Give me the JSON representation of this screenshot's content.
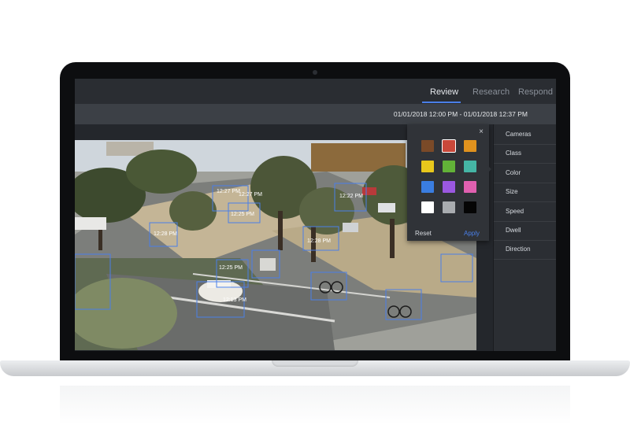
{
  "nav": {
    "tabs": [
      {
        "label": "Review",
        "active": true
      },
      {
        "label": "Research",
        "active": false
      },
      {
        "label": "Respond",
        "active": false
      }
    ]
  },
  "date_range": "01/01/2018 12:00 PM - 01/01/2018 12:37 PM",
  "filters": {
    "items": [
      "Cameras",
      "Class",
      "Color",
      "Size",
      "Speed",
      "Dwell",
      "Direction"
    ]
  },
  "color_picker": {
    "close": "×",
    "swatches": [
      "#7a4a28",
      "#c9483a",
      "#e0921e",
      "#e8c71c",
      "#62b238",
      "#45b5a5",
      "#3a7de0",
      "#9a58e0",
      "#e060b0",
      "#ffffff",
      "#a9acb0",
      "#050505"
    ],
    "selected_index": 1,
    "reset_label": "Reset",
    "apply_label": "Apply"
  },
  "detections": {
    "timestamps": [
      "12:27 PM",
      "12:27 PM",
      "12:25 PM",
      "12:28 PM",
      "12:28 PM",
      "12:25 PM",
      "12:13 PM",
      "12:22 PM"
    ]
  },
  "colors": {
    "accent": "#4a7fe8",
    "panel": "#2b2e33",
    "topbar": "#2a2d32"
  }
}
